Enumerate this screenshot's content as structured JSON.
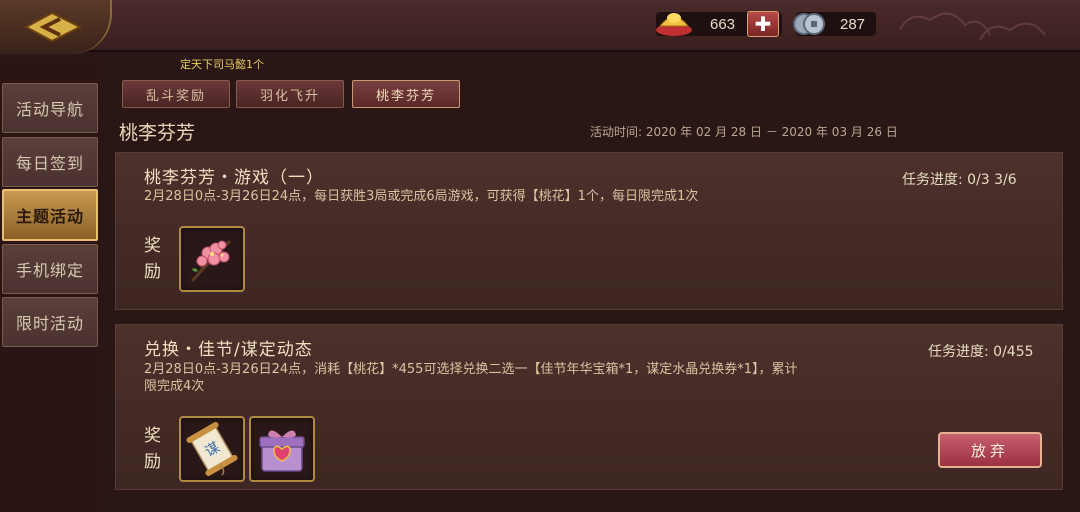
{
  "header": {
    "gold_amount": "663",
    "silver_amount": "287",
    "notice": "定天下司马懿1个"
  },
  "nav": {
    "items": [
      {
        "label": "活动导航",
        "active": false
      },
      {
        "label": "每日签到",
        "active": false
      },
      {
        "label": "主题活动",
        "active": true
      },
      {
        "label": "手机绑定",
        "active": false
      },
      {
        "label": "限时活动",
        "active": false
      }
    ]
  },
  "tabs": [
    {
      "label": "乱斗奖励",
      "active": false
    },
    {
      "label": "羽化飞升",
      "active": false
    },
    {
      "label": "桃李芬芳",
      "active": true
    }
  ],
  "section": {
    "title": "桃李芬芳",
    "time": "活动时间: 2020 年 02 月 28 日 － 2020 年 03 月 26 日"
  },
  "cards": [
    {
      "title": "桃李芬芳・游戏（一）",
      "desc": "2月28日0点-3月26日24点，每日获胜3局或完成6局游戏，可获得【桃花】1个，每日限完成1次",
      "progress": "任务进度: 0/3  3/6",
      "reward_label": "奖励",
      "rewards": [
        "peach-blossom-icon"
      ]
    },
    {
      "title": "兑换・佳节/谋定动态",
      "desc_line1": "2月28日0点-3月26日24点，消耗【桃花】*455可选择兑换二选一【佳节年华宝箱*1，谋定水晶兑换券*1】，累计",
      "desc_line2": "限完成4次",
      "progress": "任务进度: 0/455",
      "reward_label": "奖励",
      "rewards": [
        "scroll-icon",
        "gift-box-icon"
      ],
      "button": "放弃"
    }
  ],
  "colors": {
    "gold_accent": "#b08a40",
    "active_nav": "#c89a50",
    "giveup_button": "#c86070"
  }
}
